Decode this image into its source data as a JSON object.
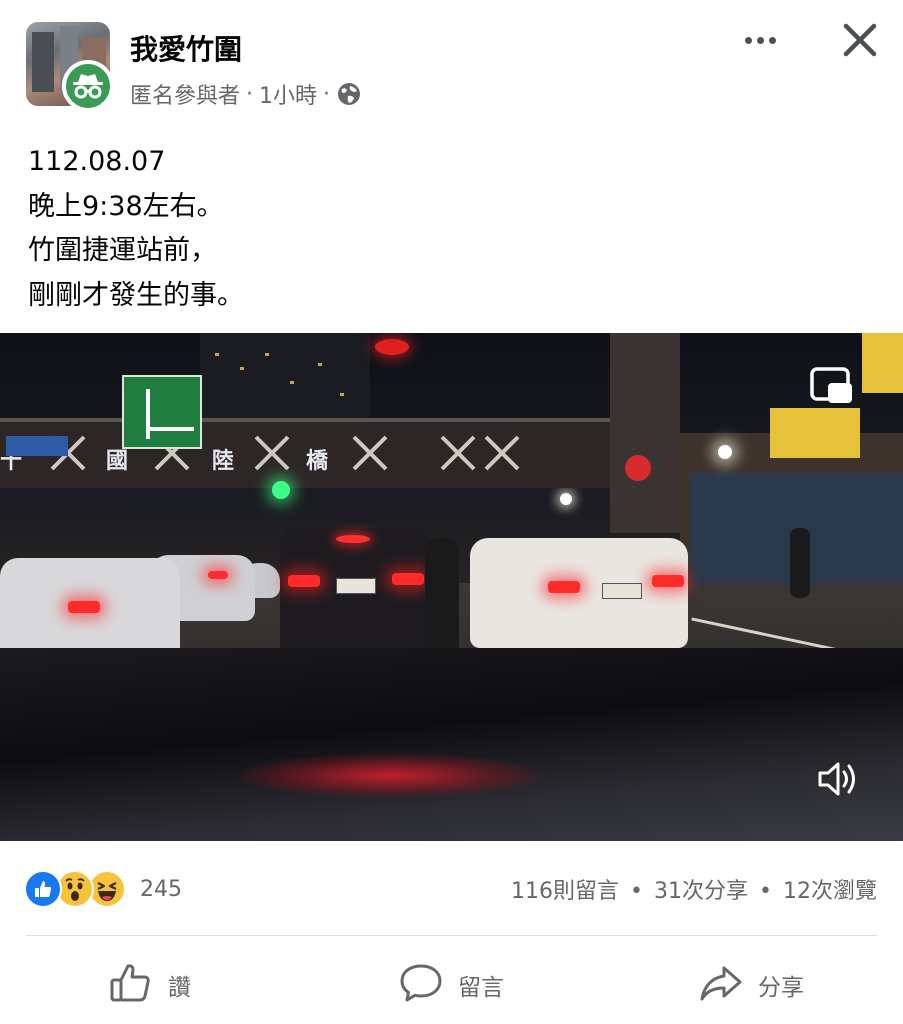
{
  "header": {
    "group_name": "我愛竹圍",
    "author": "匿名參與者",
    "separator": "·",
    "time": "1小時",
    "privacy_icon": "globe-icon",
    "more_icon": "more-horizontal-icon",
    "close_icon": "close-icon"
  },
  "post": {
    "lines": [
      "112.08.07",
      "晚上9:38左右。",
      "竹圍捷運站前，",
      "剛剛才發生的事。"
    ]
  },
  "video": {
    "bridge_chars": [
      "十",
      "國",
      "陸",
      "橋"
    ],
    "pip_icon": "picture-in-picture-icon",
    "sound_icon": "speaker-icon"
  },
  "engagement": {
    "reaction_icons": [
      "like-reaction-icon",
      "wow-reaction-icon",
      "haha-reaction-icon"
    ],
    "reaction_count": "245",
    "comments": "116則留言",
    "shares": "31次分享",
    "views": "12次瀏覽",
    "dot": "•"
  },
  "actions": {
    "like": "讚",
    "comment": "留言",
    "share": "分享"
  },
  "colors": {
    "accent": "#1877f2",
    "secondary_text": "#65676b",
    "anon_badge": "#3a9b57"
  }
}
